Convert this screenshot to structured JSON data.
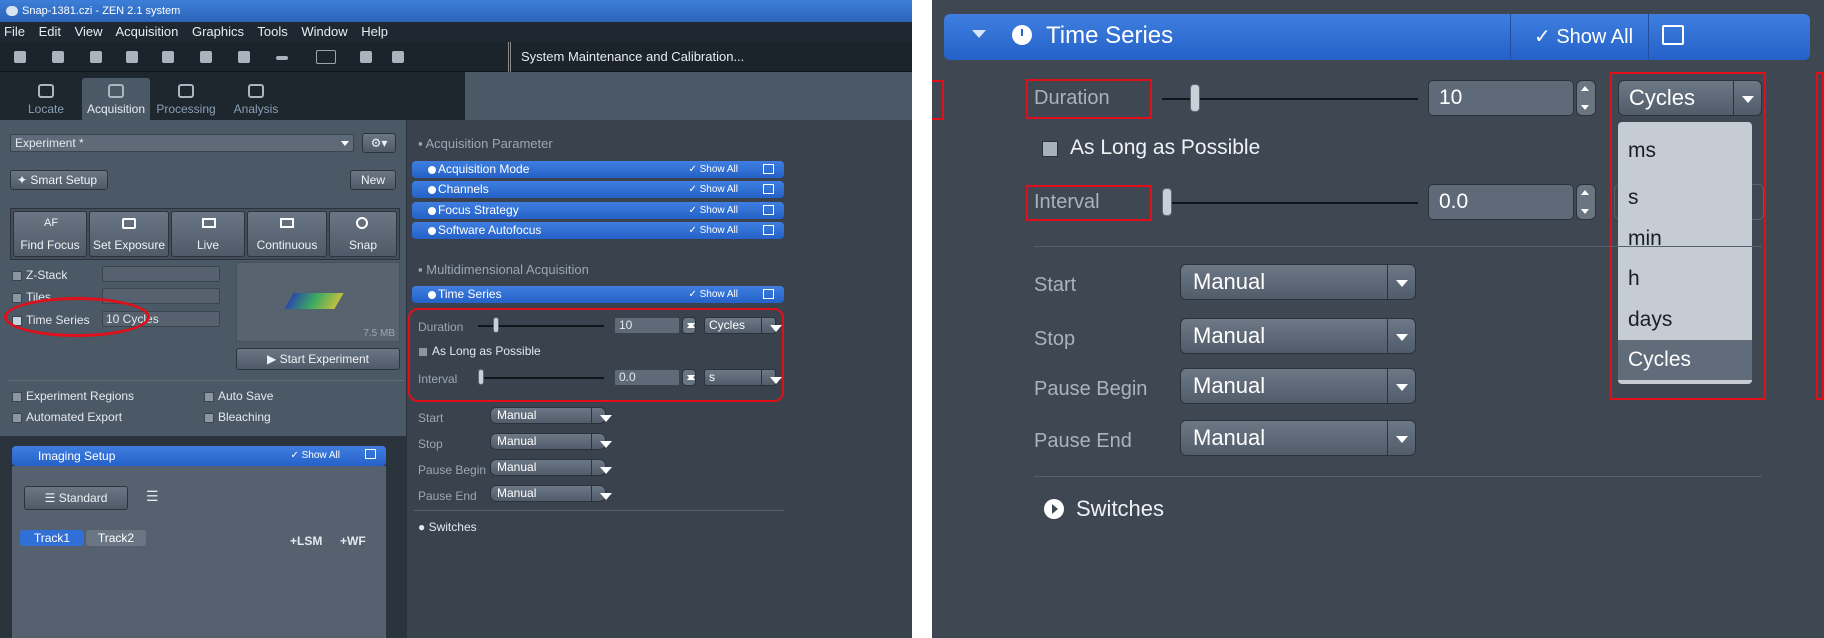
{
  "left": {
    "window_title": "Snap-1381.czi - ZEN 2.1 system",
    "menu": [
      "File",
      "Edit",
      "View",
      "Acquisition",
      "Graphics",
      "Tools",
      "Window",
      "Help"
    ],
    "system_maintenance": "System Maintenance and Calibration...",
    "tabs": [
      "Locate",
      "Acquisition",
      "Processing",
      "Analysis"
    ],
    "experiment": "Experiment *",
    "smart_setup": "Smart Setup",
    "new_label": "New",
    "acq_buttons": [
      {
        "icon": "AF",
        "label": "Find Focus"
      },
      {
        "icon": "camera",
        "label": "Set Exposure"
      },
      {
        "icon": "live",
        "label": "Live"
      },
      {
        "icon": "continuous",
        "label": "Continuous"
      },
      {
        "icon": "snap",
        "label": "Snap"
      }
    ],
    "z_stack": "Z-Stack",
    "tiles": "Tiles",
    "time_series": "Time Series",
    "time_series_value": "10 Cycles",
    "size_label": "7.5 MB",
    "start_experiment": "Start Experiment",
    "experiment_regions": "Experiment Regions",
    "auto_save": "Auto Save",
    "automated_export": "Automated Export",
    "bleaching": "Bleaching",
    "imaging_setup": "Imaging Setup",
    "show_all": "Show All",
    "standard": "Standard",
    "track1": "Track1",
    "track2": "Track2",
    "plus_lsm": "+LSM",
    "plus_wf": "+WF",
    "acq_param_header": "Acquisition Parameter",
    "acq_sections": [
      "Acquisition Mode",
      "Channels",
      "Focus Strategy",
      "Software Autofocus"
    ],
    "multi_header": "Multidimensional Acquisition",
    "ts_section": "Time Series",
    "duration_label": "Duration",
    "duration_value": "10",
    "duration_unit": "Cycles",
    "as_long": "As Long as Possible",
    "interval_label": "Interval",
    "interval_value": "0.0",
    "interval_unit": "s",
    "start_label": "Start",
    "stop_label": "Stop",
    "pause_begin_label": "Pause Begin",
    "pause_end_label": "Pause End",
    "manual": "Manual",
    "switches": "Switches"
  },
  "right": {
    "section_title": "Time Series",
    "show_all": "Show All",
    "duration_label": "Duration",
    "duration_value": "10",
    "duration_unit": "Cycles",
    "as_long": "As Long as Possible",
    "interval_label": "Interval",
    "interval_value": "0.0",
    "unit_options": [
      "ms",
      "s",
      "min",
      "h",
      "days",
      "Cycles"
    ],
    "selected_unit": "Cycles",
    "start_label": "Start",
    "stop_label": "Stop",
    "pause_begin_label": "Pause Begin",
    "pause_end_label": "Pause End",
    "manual": "Manual",
    "switches": "Switches"
  },
  "colors": {
    "annotation_red": "#e0101a",
    "section_blue": "#2f6fd6",
    "panel_gray": "#3f4753"
  }
}
